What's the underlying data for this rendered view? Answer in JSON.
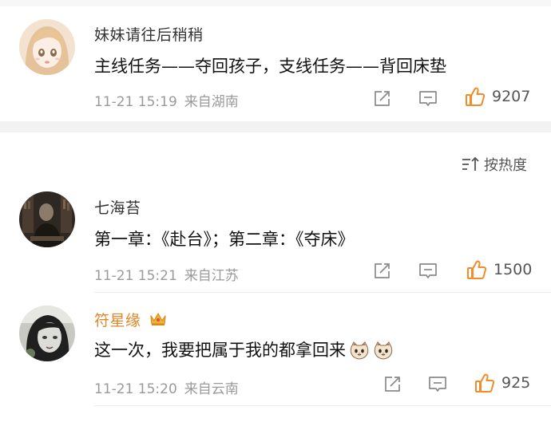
{
  "comments_top": {
    "user": "妹妹请往后稍稍",
    "text": "主线任务——夺回孩子，支线任务——背回床垫",
    "time": "11-21 15:19",
    "source": "来自湖南",
    "likes": "9207"
  },
  "sort": {
    "label": "按热度",
    "icon": "sort-icon"
  },
  "comments": [
    {
      "user": "七海苔",
      "text": "第一章：《赴台》；第二章：《夺床》",
      "time": "11-21 15:21",
      "source": "来自江苏",
      "likes": "1500"
    },
    {
      "user": "符星缘",
      "text": "这一次，我要把属于我的都拿回来",
      "time": "11-21 15:20",
      "source": "来自云南",
      "likes": "925",
      "emoji": [
        "cat-face-emoji",
        "cat-face-emoji"
      ]
    }
  ],
  "colors": {
    "like_orange": "#f58a28",
    "gold_name": "#e0872a",
    "meta_gray": "#9a9a9a",
    "divider": "#f2f2f2"
  }
}
